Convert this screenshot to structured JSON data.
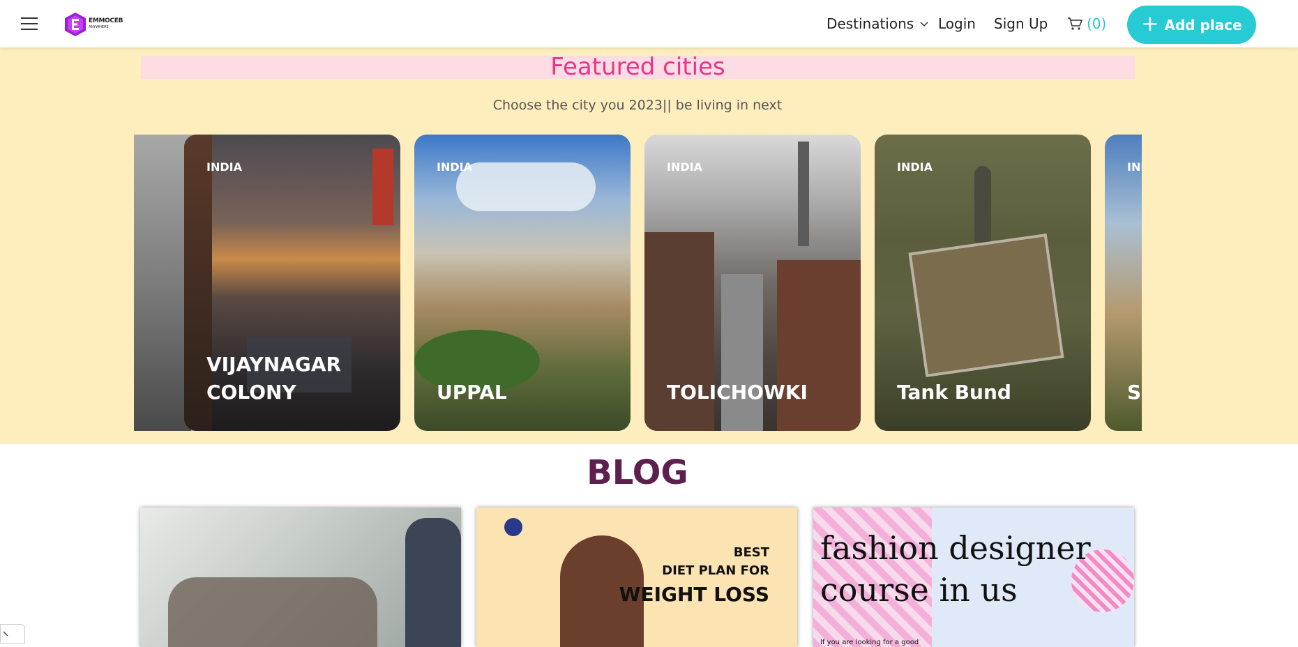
{
  "header": {
    "logo_line1": "EMMOCEB",
    "logo_line2": "ANYWHERE",
    "nav_destinations": "Destinations",
    "nav_login": "Login",
    "nav_signup": "Sign Up",
    "cart_count": "(0)",
    "add_place": "Add place",
    "brand_color": "#27cbd4"
  },
  "featured": {
    "title": "Featured cities",
    "subtitle": "Choose the city you 2023|| be living in next",
    "cards": [
      {
        "country": "INDIA",
        "name": "VIJAYNAGAR COLONY"
      },
      {
        "country": "INDIA",
        "name": "UPPAL"
      },
      {
        "country": "INDIA",
        "name": "TOLICHOWKI"
      },
      {
        "country": "INDIA",
        "name": "Tank Bund"
      },
      {
        "country": "INDIA",
        "name": "SECUNDERABAD"
      }
    ]
  },
  "blog": {
    "title": "BLOG",
    "posts": [
      {
        "kind": "photo"
      },
      {
        "line1": "BEST",
        "line2": "DIET PLAN FOR",
        "line3": "WEIGHT LOSS"
      },
      {
        "title": "fashion designer course in us",
        "snippet": "If you are looking for a good"
      }
    ]
  }
}
